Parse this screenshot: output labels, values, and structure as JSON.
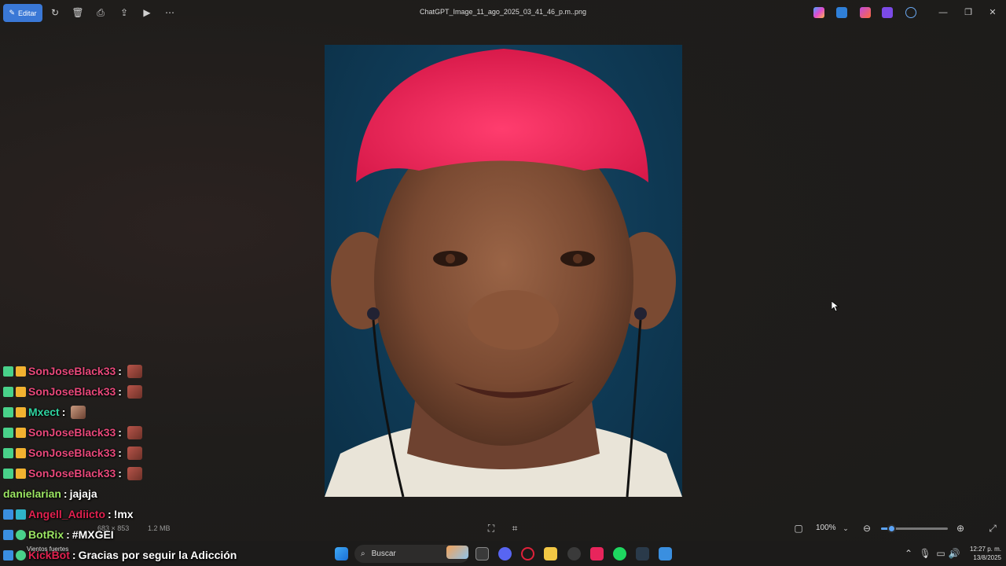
{
  "toolbar": {
    "edit_label": "Editar",
    "file_title": "ChatGPT_Image_11_ago_2025_03_41_46_p.m..png",
    "icons": [
      "rotate-icon",
      "delete-icon",
      "print-icon",
      "share-icon",
      "slideshow-icon",
      "more-icon"
    ]
  },
  "statusbar": {
    "dimensions": "683 × 853",
    "file_size": "1.2 MB",
    "zoom": "100%",
    "zoom_level": 0.15
  },
  "taskbar": {
    "search_placeholder": "Buscar",
    "time": "12:27 p. m.",
    "date": "13/8/2025",
    "weather_text": "Vientos fuertes"
  },
  "chat": {
    "colors": {
      "pink": "#e8487a",
      "green": "#49d18a",
      "red": "#e0214f",
      "lime": "#9be562"
    },
    "lines": [
      {
        "user": "SonJoseBlack33",
        "sep": ":",
        "text": "",
        "color": "#e8487a"
      },
      {
        "user": "SonJoseBlack33",
        "sep": ":",
        "text": "",
        "color": "#e8487a"
      },
      {
        "user": "Mxect",
        "sep": ":",
        "text": "",
        "color": "#2fd3a0"
      },
      {
        "user": "SonJoseBlack33",
        "sep": ":",
        "text": "",
        "color": "#e8487a"
      },
      {
        "user": "SonJoseBlack33",
        "sep": ":",
        "text": "",
        "color": "#e8487a"
      },
      {
        "user": "SonJoseBlack33",
        "sep": ":",
        "text": "",
        "color": "#e8487a"
      },
      {
        "user": "danielarian",
        "sep": ":",
        "text": "jajaja",
        "color": "#9be562"
      },
      {
        "user": "Angell_Adiicto",
        "sep": ":",
        "text": "!mx",
        "color": "#e0214f"
      },
      {
        "user": "BotRix",
        "sep": ":",
        "text": "#MXGEI",
        "color": "#9be562"
      },
      {
        "user": "KickBot",
        "sep": ":",
        "text": "Gracias por seguir la Adicción",
        "color": "#e0214f"
      }
    ]
  }
}
